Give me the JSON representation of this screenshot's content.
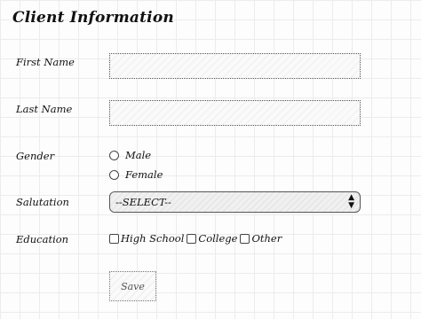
{
  "form": {
    "title": "Client Information",
    "first_name": {
      "label": "First Name",
      "value": ""
    },
    "last_name": {
      "label": "Last Name",
      "value": ""
    },
    "gender": {
      "label": "Gender",
      "options": [
        "Male",
        "Female"
      ]
    },
    "salutation": {
      "label": "Salutation",
      "selected": "--SELECT--"
    },
    "education": {
      "label": "Education",
      "options": [
        "High School",
        "College",
        "Other"
      ]
    },
    "save_label": "Save"
  }
}
